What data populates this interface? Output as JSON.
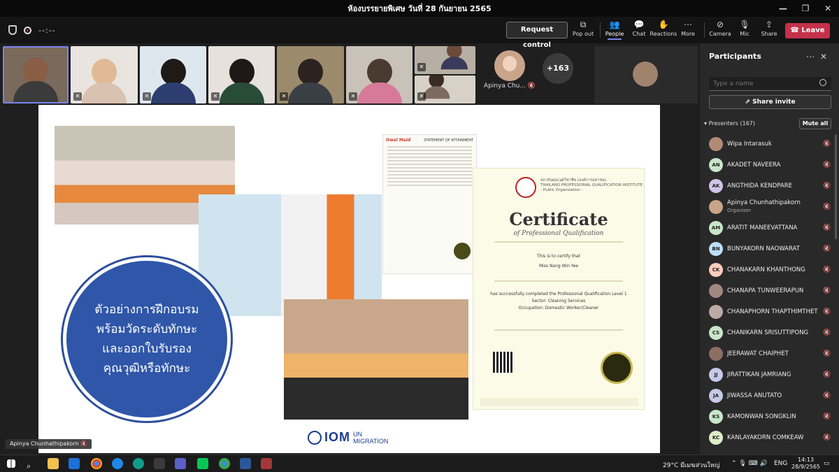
{
  "window": {
    "title": "ห้องบรรยายพิเศษ วันที่ 28 กันยายน 2565",
    "controls": [
      "—",
      "❐",
      "✕"
    ]
  },
  "toolbar": {
    "timer": "--:--",
    "request_control": "Request control",
    "pop_out": "Pop out",
    "people": "People",
    "chat": "Chat",
    "reactions": "Reactions",
    "more": "More",
    "camera": "Camera",
    "mic": "Mic",
    "share": "Share",
    "leave": "Leave"
  },
  "video_strip": {
    "avatar_name": "Apinya Chu...",
    "overflow_count": "+163"
  },
  "slide": {
    "circle_text": [
      "ตัวอย่างการฝึกอบรม",
      "พร้อมวัดระดับทักษะ",
      "และออกใบรับรอง",
      "คุณวุฒิหรือทักษะ"
    ],
    "logo_iom": "IOM",
    "logo_un": "UN",
    "logo_migration": "MIGRATION",
    "statement_brand": "Owal Maid",
    "statement_title": "STATEMENT OF ATTAINMENT",
    "certificate": {
      "institute_th": "สถาบันคุณวุฒิวิชาชีพ (องค์การมหาชน)",
      "institute_en": "THAILAND PROFESSIONAL QUALIFICATION INSTITUTE",
      "public_org": "- Public Organization -",
      "title": "Certificate",
      "subtitle": "of Professional Qualification",
      "certify": "This is to certify that",
      "name": "Miss Nang Win Yee",
      "completed": "has successfully completed the Professional Qualification Level 1",
      "sector": "Sector: Cleaning Services",
      "occupation": "Occupation: Domestic Worker/Cleaner"
    }
  },
  "speaker_tag": "Apinya Chunhathipakorn",
  "participants": {
    "title": "Participants",
    "search_placeholder": "Type a name",
    "share_invite": "Share invite",
    "presenters_label": "Presenters (167)",
    "mute_all": "Mute all",
    "list": [
      {
        "name": "Wipa Intarasuk",
        "initials": "",
        "color": "#b08a77",
        "role": ""
      },
      {
        "name": "AKADET NAVEERA",
        "initials": "AN",
        "color": "#c8e6c9",
        "role": ""
      },
      {
        "name": "ANGTHIDA KENDPARE",
        "initials": "AK",
        "color": "#d1c4e9",
        "role": ""
      },
      {
        "name": "Apinya Chunhathipakorn",
        "initials": "",
        "color": "#c9a48a",
        "role": "Organizer"
      },
      {
        "name": "ARATIT MANEEVATTANA",
        "initials": "AM",
        "color": "#c8e6c9",
        "role": ""
      },
      {
        "name": "BUNYAKORN NAOWARAT",
        "initials": "BN",
        "color": "#bbdefb",
        "role": ""
      },
      {
        "name": "CHANAKARN KHANTHONG",
        "initials": "CK",
        "color": "#ffccbc",
        "role": ""
      },
      {
        "name": "CHANAPA TUNWEERAPUN",
        "initials": "",
        "color": "#a1887f",
        "role": ""
      },
      {
        "name": "CHANAPHORN THAPTHIMTHET",
        "initials": "",
        "color": "#bcaaa4",
        "role": ""
      },
      {
        "name": "CHANIKARN SRISUTTIPONG",
        "initials": "CS",
        "color": "#c8e6c9",
        "role": ""
      },
      {
        "name": "JEERAWAT CHAIPHET",
        "initials": "",
        "color": "#8d6e63",
        "role": ""
      },
      {
        "name": "JIRATTIKAN JAMRIANG",
        "initials": "JJ",
        "color": "#c5cae9",
        "role": ""
      },
      {
        "name": "JIWASSA ANUTATO",
        "initials": "JA",
        "color": "#c5cae9",
        "role": ""
      },
      {
        "name": "KAMONWAN SONGKLIN",
        "initials": "KS",
        "color": "#c8e6c9",
        "role": ""
      },
      {
        "name": "KANLAYAKORN COMKEAW",
        "initials": "KC",
        "color": "#dcedc8",
        "role": ""
      }
    ]
  },
  "taskbar": {
    "weather": "29°C  มีเมฆส่วนใหญ่",
    "lang": "ENG",
    "time": "14:13",
    "date": "28/9/2565"
  }
}
